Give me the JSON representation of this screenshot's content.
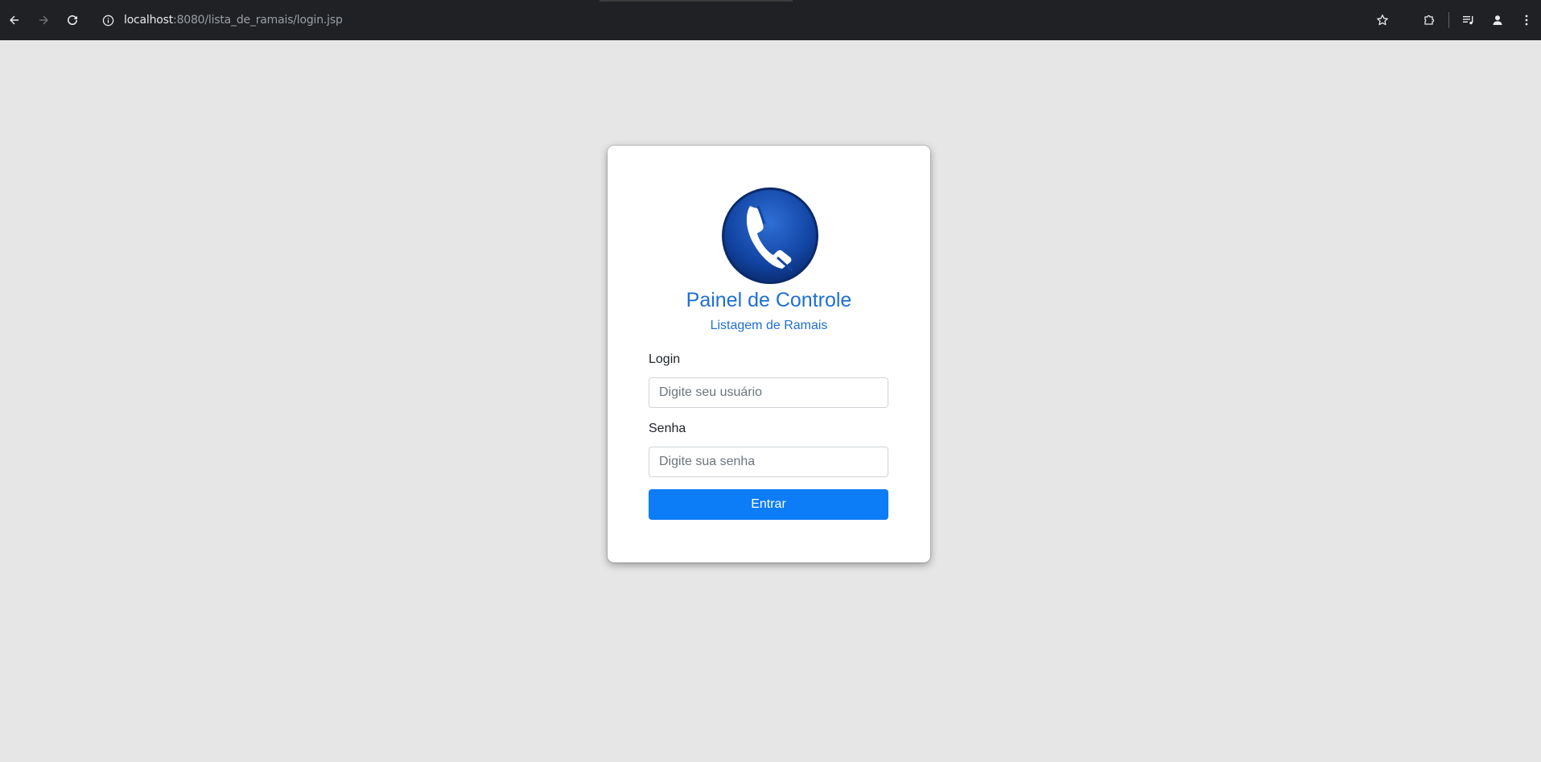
{
  "browser": {
    "url_host": "localhost",
    "url_rest": ":8080/lista_de_ramais/login.jsp"
  },
  "login_card": {
    "logo_icon": "phone-handset-icon",
    "title": "Painel de Controle",
    "subtitle": "Listagem de Ramais",
    "login": {
      "label": "Login",
      "placeholder": "Digite seu usuário",
      "value": ""
    },
    "password": {
      "label": "Senha",
      "placeholder": "Digite sua senha",
      "value": ""
    },
    "submit_label": "Entrar"
  },
  "colors": {
    "accent": "#0d7cf7",
    "title": "#1e6fd4",
    "background": "#e6e6e6",
    "browser_bar": "#202124"
  }
}
